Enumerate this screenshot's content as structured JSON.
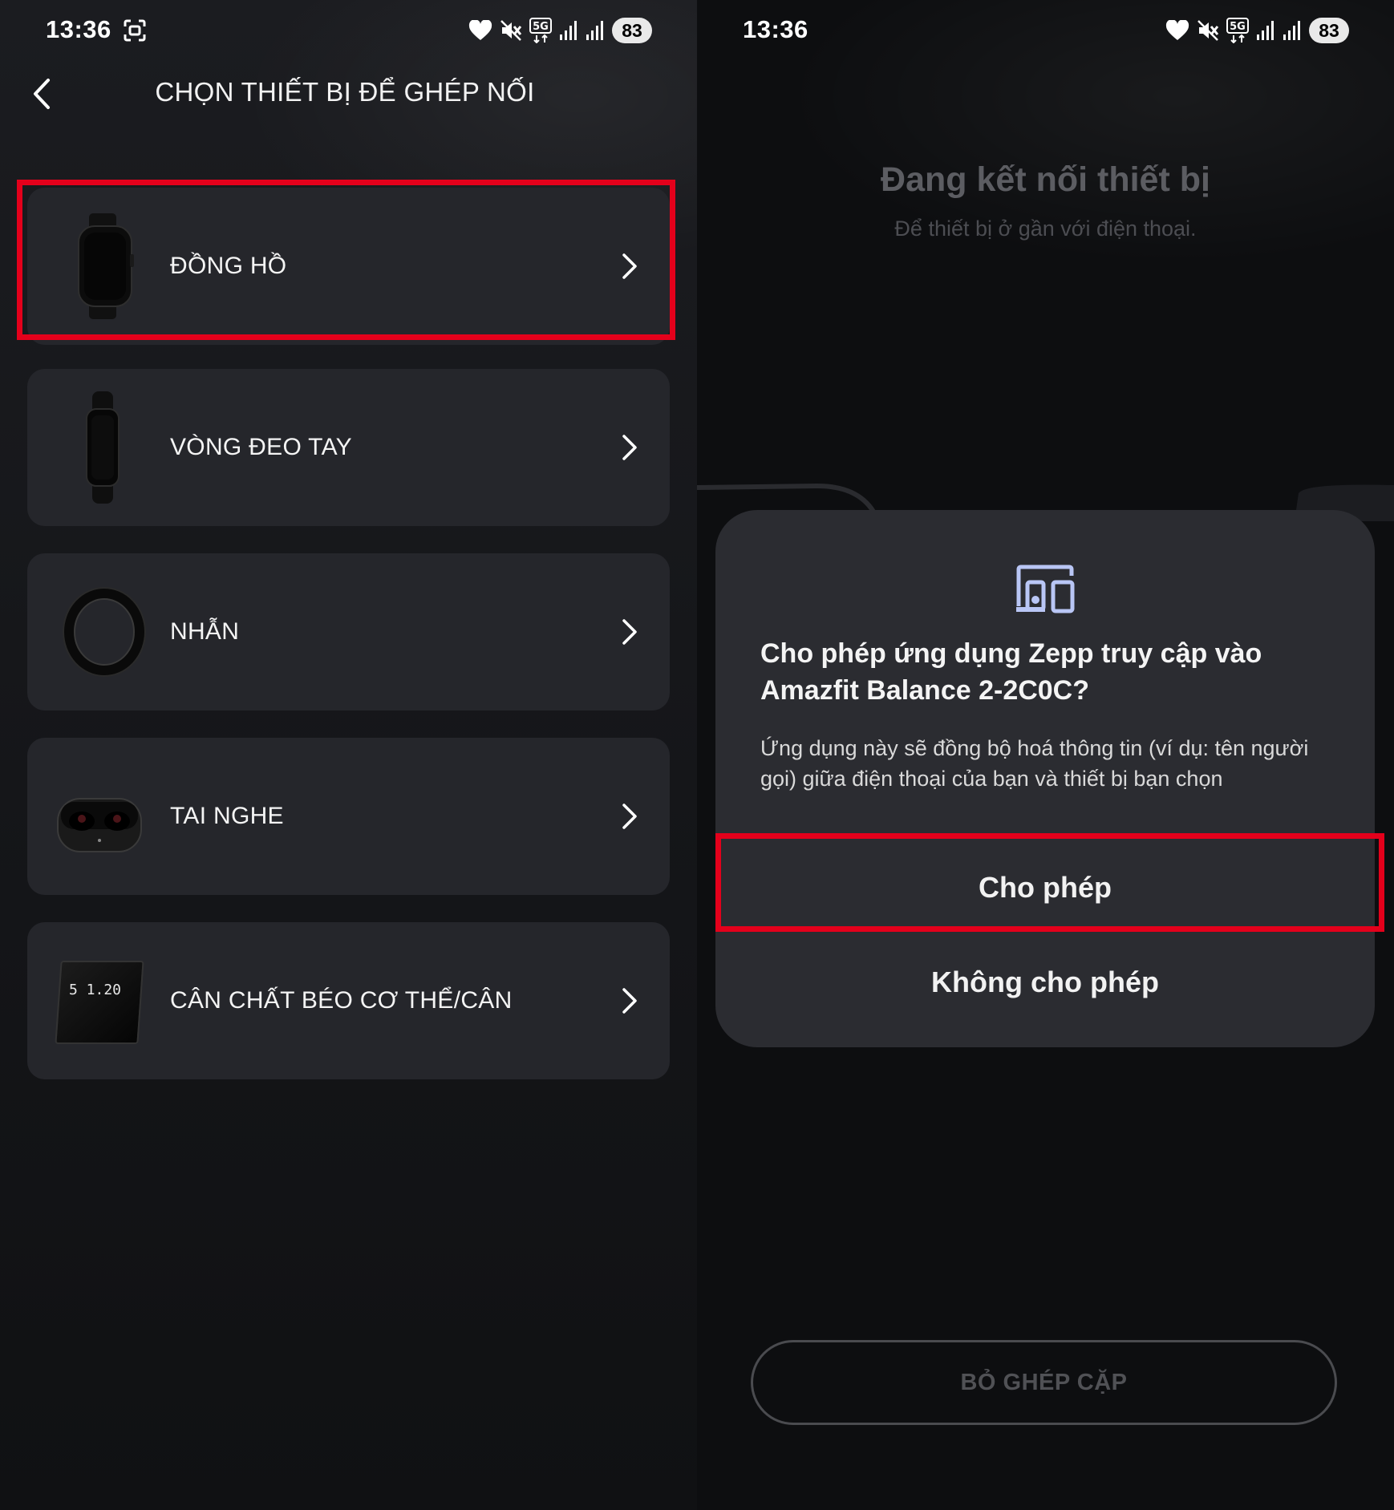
{
  "left": {
    "status": {
      "time": "13:36",
      "battery": "83"
    },
    "title": "CHỌN THIẾT BỊ ĐỂ GHÉP NỐI",
    "devices": [
      {
        "label": "ĐỒNG HỒ",
        "icon": "watch-icon"
      },
      {
        "label": "VÒNG ĐEO TAY",
        "icon": "band-icon"
      },
      {
        "label": "NHẪN",
        "icon": "ring-icon"
      },
      {
        "label": "TAI NGHE",
        "icon": "earbuds-icon"
      },
      {
        "label": "CÂN CHẤT BÉO CƠ THỂ/CÂN",
        "icon": "scale-icon",
        "scale_reading": "5 1.20"
      }
    ]
  },
  "right": {
    "status": {
      "time": "13:36",
      "battery": "83"
    },
    "connecting_title": "Đang kết nối thiết bị",
    "connecting_subtitle": "Để thiết bị ở gần với điện thoại.",
    "dialog": {
      "title": "Cho phép ứng dụng Zepp truy cập vào Amazfit Balance 2-2C0C?",
      "body": "Ứng dụng này sẽ đồng bộ hoá thông tin (ví dụ: tên người gọi) giữa điện thoại của bạn và thiết bị bạn chọn",
      "allow_label": "Cho phép",
      "deny_label": "Không cho phép"
    },
    "unpair_label": "BỎ GHÉP CẶP"
  },
  "colors": {
    "highlight": "#e4001b",
    "card": "#25262b",
    "dialog": "#2b2c31",
    "accent_icon": "#b9c6f5"
  }
}
